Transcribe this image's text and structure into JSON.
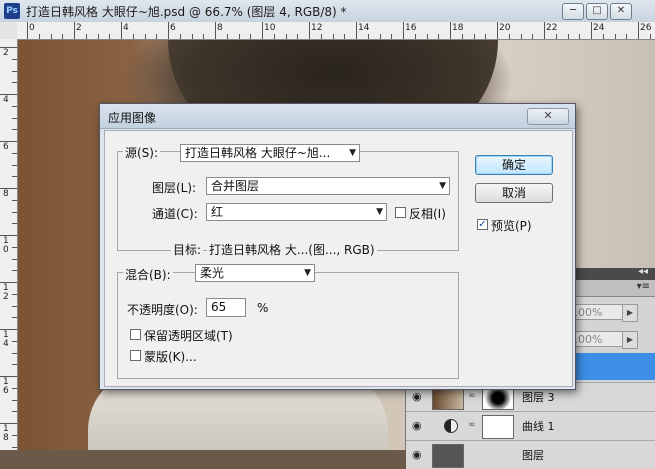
{
  "window": {
    "title": "打造日韩风格 大眼仔~旭.psd @ 66.7% (图层 4, RGB/8) *",
    "app_icon_text": "Ps",
    "minimize": "─",
    "maximize": "□",
    "close": "✕"
  },
  "rulers": {
    "h_labels": [
      "0",
      "2",
      "4",
      "6",
      "8",
      "10",
      "12",
      "14",
      "16",
      "18",
      "20",
      "22",
      "24",
      "26"
    ],
    "v_labels": [
      "2",
      "4",
      "6",
      "8",
      "1\n0",
      "1\n2",
      "1\n4",
      "1\n6",
      "1\n8"
    ]
  },
  "layers_panel": {
    "collapse": "◂◂",
    "menu": "▾≡",
    "opacity_value": "100%",
    "fill_value": "100%",
    "layers": [
      {
        "name": "图层 3",
        "visible": true
      },
      {
        "name": "曲线 1",
        "visible": true
      },
      {
        "name": "图层",
        "visible": true
      }
    ]
  },
  "dialog": {
    "title": "应用图像",
    "close_label": "✕",
    "source_label": "源(S):",
    "source_value": "打造日韩风格 大眼仔~旭...",
    "layer_label": "图层(L):",
    "layer_value": "合并图层",
    "channel_label": "通道(C):",
    "channel_value": "红",
    "invert_label": "反相(I)",
    "invert_checked": false,
    "target_label": "目标:",
    "target_value": "打造日韩风格 大...(图..., RGB)",
    "blend_label": "混合(B):",
    "blend_value": "柔光",
    "opacity_label": "不透明度(O):",
    "opacity_value": "65",
    "opacity_unit": "%",
    "preserve_label": "保留透明区域(T)",
    "preserve_checked": false,
    "mask_label": "蒙版(K)...",
    "mask_checked": false,
    "ok_label": "确定",
    "cancel_label": "取消",
    "preview_label": "预览(P)",
    "preview_checked": true,
    "dropdown_arrow": "▼"
  },
  "colors": {
    "selection_blue": "#3d8ee6",
    "default_button_border": "#3c7fb1"
  }
}
